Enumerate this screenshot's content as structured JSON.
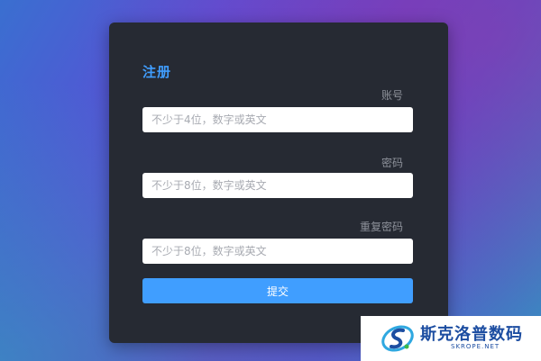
{
  "form": {
    "title": "注册",
    "fields": [
      {
        "label": "账号",
        "placeholder": "不少于4位，数字或英文",
        "value": ""
      },
      {
        "label": "密码",
        "placeholder": "不少于8位，数字或英文",
        "value": ""
      },
      {
        "label": "重复密码",
        "placeholder": "不少于8位，数字或英文",
        "value": ""
      }
    ],
    "submit_label": "提交"
  },
  "watermark": {
    "name": "斯克洛普数码",
    "domain": "SKROPE.NET"
  },
  "colors": {
    "accent": "#409eff",
    "card": "#262a33",
    "label": "#8d919a"
  }
}
